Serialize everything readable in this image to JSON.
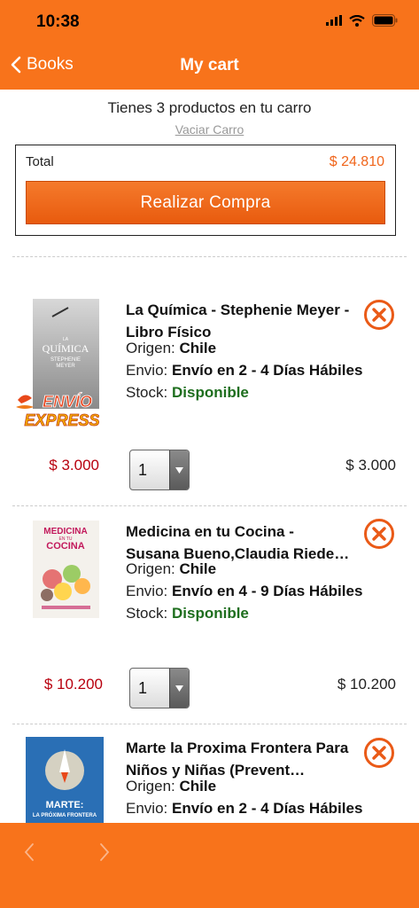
{
  "status": {
    "time": "10:38"
  },
  "nav": {
    "back_label": "Books",
    "title": "My cart"
  },
  "summary": {
    "text": "Tienes 3 productos en tu carro",
    "empty_link": "Vaciar Carro",
    "total_label": "Total",
    "total_value": "$ 24.810",
    "buy_label": "Realizar Compra"
  },
  "colors": {
    "brand": "#f8731b",
    "price_red": "#b8000e",
    "stock_green": "#1e6e1e"
  },
  "items": [
    {
      "title": "La Química - Stephenie Meyer - Libro Físico",
      "origin_label": "Origen:",
      "origin_value": "Chile",
      "shipping_label": "Envio:",
      "shipping_value": "Envío en 2 - 4 Días Hábiles",
      "stock_label": "Stock:",
      "stock_value": "Disponible",
      "unit_price": "$ 3.000",
      "quantity": "1",
      "line_total": "$ 3.000",
      "cover_text": [
        "LA",
        "QUÍMICA",
        "STEPHENIE",
        "MEYER"
      ],
      "badge": [
        "ENVÍO",
        "EXPRESS"
      ]
    },
    {
      "title": "Medicina en tu Cocina - Susana Bueno,Claudia Riede…",
      "origin_label": "Origen:",
      "origin_value": "Chile",
      "shipping_label": "Envio:",
      "shipping_value": "Envío en 4 - 9 Días Hábiles",
      "stock_label": "Stock:",
      "stock_value": "Disponible",
      "unit_price": "$ 10.200",
      "quantity": "1",
      "line_total": "$ 10.200",
      "cover_text": [
        "MEDICINA",
        "EN TU",
        "COCINA"
      ]
    },
    {
      "title": "Marte la Proxima Frontera Para Niños y Niñas (Prevent…",
      "origin_label": "Origen:",
      "origin_value": "Chile",
      "shipping_label": "Envio:",
      "shipping_value": "Envío en 2 - 4 Días Hábiles",
      "cover_text": [
        "MARTE:",
        "LA PRÓXIMA FRONTERA"
      ]
    }
  ],
  "icons": {
    "remove": "close-circle-icon",
    "dropdown": "triangle-down-icon",
    "back": "chevron-left-icon",
    "forward": "chevron-right-icon"
  }
}
